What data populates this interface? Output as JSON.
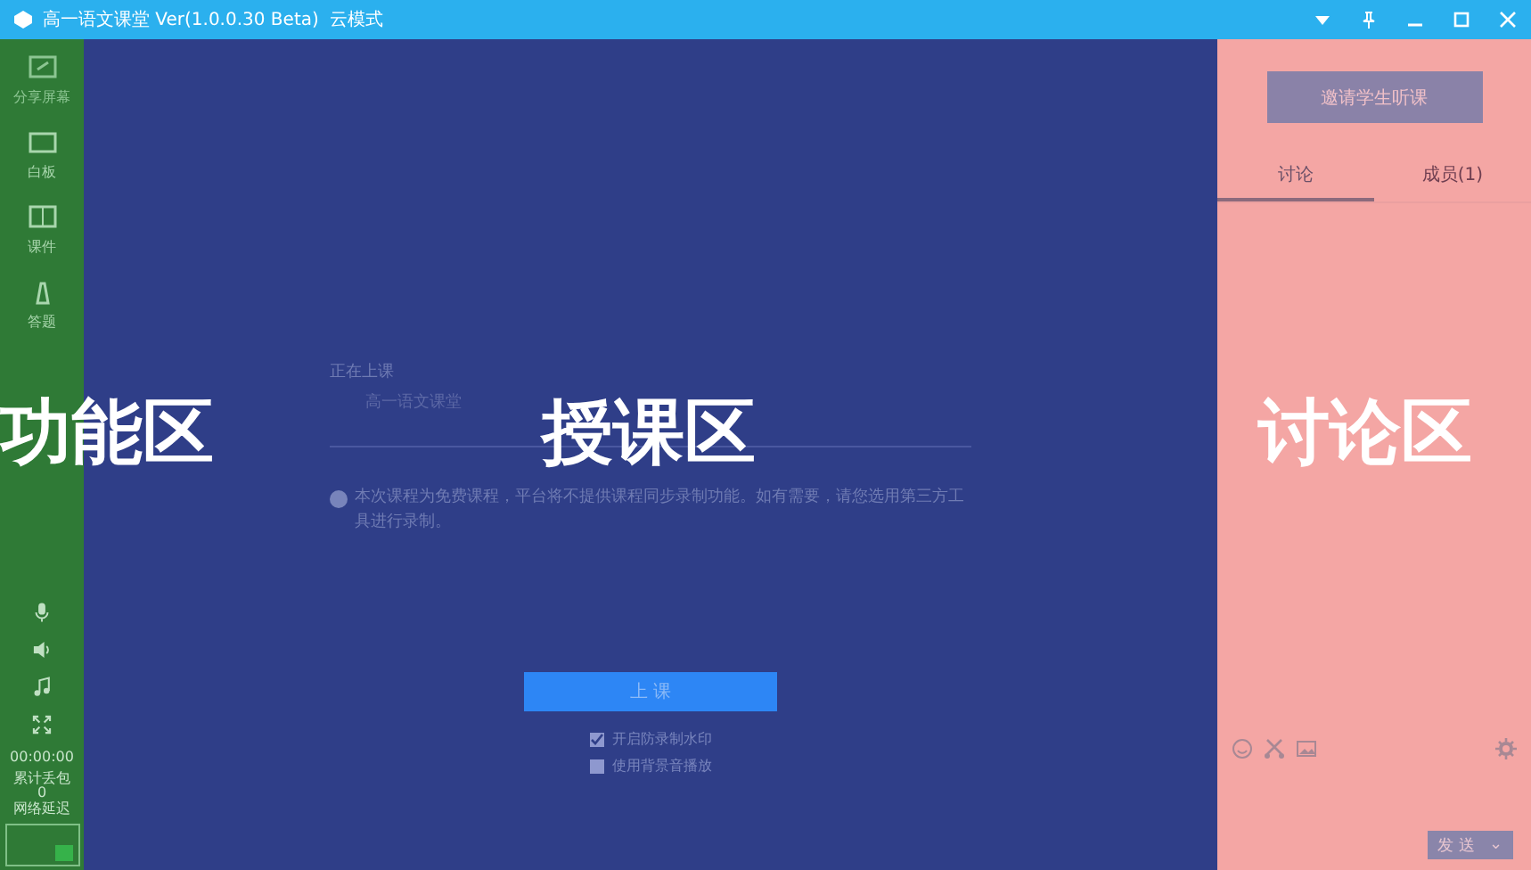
{
  "window": {
    "title": "高一语文课堂 Ver(1.0.0.30 Beta)",
    "mode": "云模式"
  },
  "sidebar": {
    "items": [
      {
        "label": "分享屏幕",
        "kind": "screen"
      },
      {
        "label": "白板",
        "kind": "board"
      },
      {
        "label": "课件",
        "kind": "slides"
      },
      {
        "label": "答题",
        "kind": "pen"
      }
    ],
    "controls": [
      {
        "kind": "mic"
      },
      {
        "kind": "speaker"
      },
      {
        "kind": "music"
      },
      {
        "kind": "fullscreen"
      }
    ],
    "timer": "00:00:00",
    "loss_label": "累计丢包",
    "loss_value": "0",
    "latency_label": "网络延迟"
  },
  "class_area": {
    "status": "正在上课",
    "course": "高一语文课堂",
    "notice": "本次课程为免费课程，平台将不提供课程同步录制功能。如有需要，请您选用第三方工具进行录制。",
    "start_button": "上 课",
    "options": [
      {
        "label": "开启防录制水印",
        "checked": true
      },
      {
        "label": "使用背景音播放",
        "checked": false
      }
    ]
  },
  "discussion": {
    "invite_button": "邀请学生听课",
    "tabs": [
      {
        "label": "讨论",
        "selected": true
      },
      {
        "label": "成员(1)",
        "selected": false
      }
    ],
    "send_button": "发 送",
    "send_menu": "⌄"
  },
  "region_labels": [
    "功能区",
    "授课区",
    "讨论区"
  ]
}
